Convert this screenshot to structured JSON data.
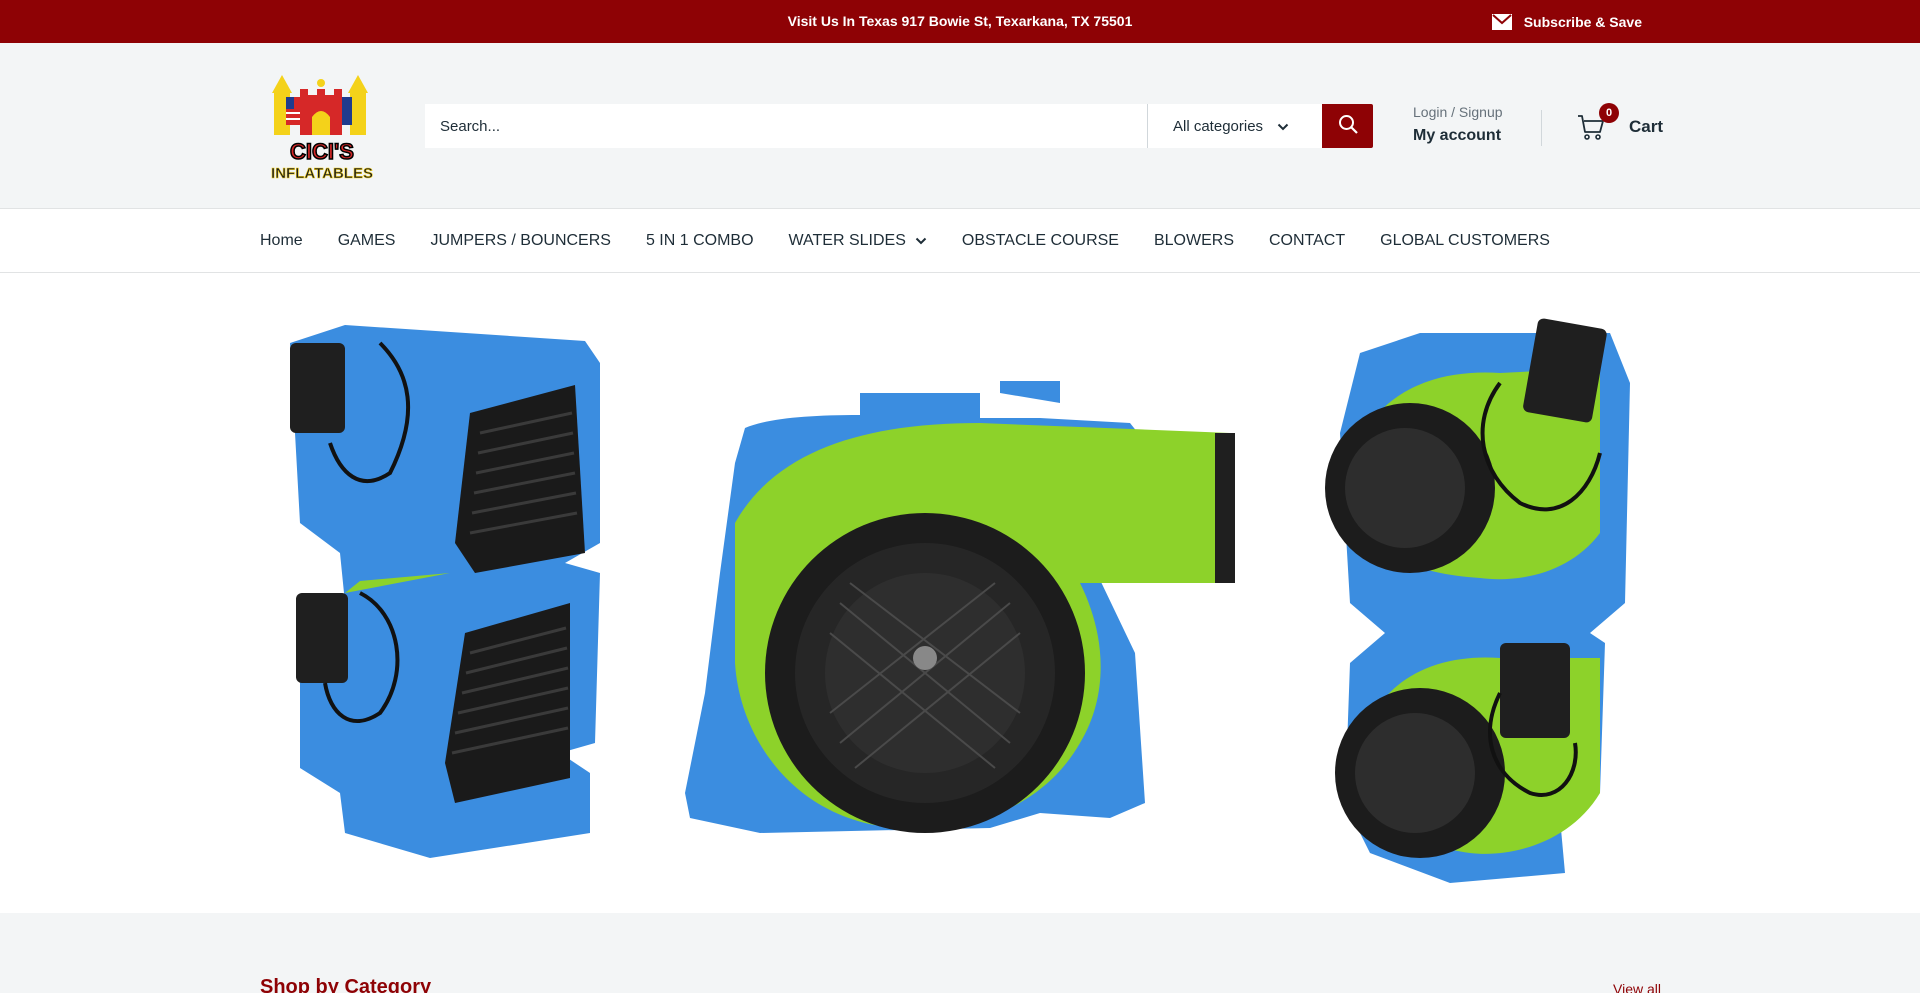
{
  "announcement": {
    "text": "Visit Us In Texas 917 Bowie St, Texarkana, TX 75501",
    "subscribe_label": "Subscribe & Save",
    "subscribe_icon": "envelope-icon"
  },
  "header": {
    "logo_text_top": "CICI'S",
    "logo_text_bottom": "INFLATABLES",
    "search": {
      "placeholder": "Search...",
      "value": "",
      "category": "All categories",
      "button_icon": "search-icon"
    },
    "account": {
      "login_label": "Login / Signup",
      "my_account_label": "My account"
    },
    "cart": {
      "label": "Cart",
      "count": "0",
      "icon": "cart-icon"
    }
  },
  "nav": {
    "items": [
      {
        "label": "Home",
        "has_dropdown": false
      },
      {
        "label": "GAMES",
        "has_dropdown": false
      },
      {
        "label": "JUMPERS / BOUNCERS",
        "has_dropdown": false
      },
      {
        "label": "5 IN 1 COMBO",
        "has_dropdown": false
      },
      {
        "label": "WATER SLIDES",
        "has_dropdown": true
      },
      {
        "label": "OBSTACLE COURSE",
        "has_dropdown": false
      },
      {
        "label": "BLOWERS",
        "has_dropdown": false
      },
      {
        "label": "CONTACT",
        "has_dropdown": false
      },
      {
        "label": "GLOBAL CUSTOMERS",
        "has_dropdown": false
      }
    ]
  },
  "hero": {
    "image": "blue and green inflatable blowers product banner"
  },
  "shop_by_category": {
    "title": "Shop by Category",
    "view_all_label": "View all"
  },
  "colors": {
    "brand": "#8e0205",
    "blower_blue": "#3b8de0",
    "blower_green": "#8dd22a"
  }
}
